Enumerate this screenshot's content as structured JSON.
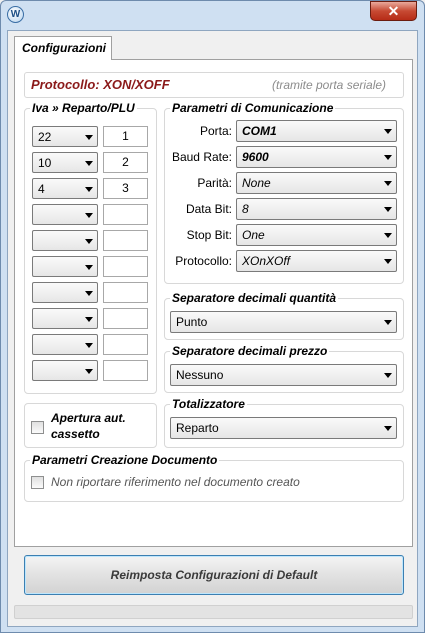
{
  "window": {
    "app_icon_glyph": "W",
    "close_glyph": "✕"
  },
  "tabs": [
    {
      "label": "Configurazioni",
      "active": true
    }
  ],
  "protocol": {
    "title": "Protocollo: XON/XOFF",
    "note": "(tramite porta seriale)"
  },
  "iva": {
    "title": "Iva » Reparto/PLU",
    "rows": [
      {
        "iva": "22",
        "reparto": "1"
      },
      {
        "iva": "10",
        "reparto": "2"
      },
      {
        "iva": "4",
        "reparto": "3"
      },
      {
        "iva": "",
        "reparto": ""
      },
      {
        "iva": "",
        "reparto": ""
      },
      {
        "iva": "",
        "reparto": ""
      },
      {
        "iva": "",
        "reparto": ""
      },
      {
        "iva": "",
        "reparto": ""
      },
      {
        "iva": "",
        "reparto": ""
      },
      {
        "iva": "",
        "reparto": ""
      }
    ]
  },
  "comm": {
    "title": "Parametri di Comunicazione",
    "porta_label": "Porta:",
    "porta_value": "COM1",
    "baud_label": "Baud Rate:",
    "baud_value": "9600",
    "parita_label": "Parità:",
    "parita_value": "None",
    "databit_label": "Data Bit:",
    "databit_value": "8",
    "stopbit_label": "Stop Bit:",
    "stopbit_value": "One",
    "protocollo_label": "Protocollo:",
    "protocollo_value": "XOnXOff"
  },
  "sep_quantita": {
    "title": "Separatore decimali quantità",
    "value": "Punto"
  },
  "sep_prezzo": {
    "title": "Separatore decimali prezzo",
    "value": "Nessuno"
  },
  "totalizzatore": {
    "title": "Totalizzatore",
    "value": "Reparto"
  },
  "cassetto": {
    "label_line1": "Apertura aut.",
    "label_line2": "cassetto",
    "checked": false
  },
  "documento": {
    "title": "Parametri Creazione Documento",
    "option_label": "Non riportare riferimento nel documento creato",
    "checked": false
  },
  "reset_button": "Reimposta Configurazioni di Default",
  "colors": {
    "protocol_title": "#8b1a1a",
    "button_border": "#3c7fb1",
    "close_button": "#c74a33"
  }
}
